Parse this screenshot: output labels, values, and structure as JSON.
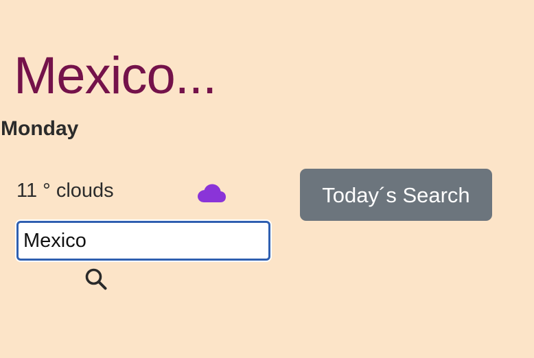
{
  "header": {
    "city_title": "Mexico..."
  },
  "forecast": {
    "day": "Monday",
    "weather_text": "11 ° clouds",
    "weather_icon": "cloud-icon",
    "icon_color": "#8a34d8"
  },
  "search": {
    "value": "Mexico",
    "button_icon": "search-icon"
  },
  "actions": {
    "today_search_label": "Today´s Search",
    "button_color": "#6c757d"
  },
  "theme": {
    "background": "#fce4c8",
    "title_color": "#74124a"
  }
}
